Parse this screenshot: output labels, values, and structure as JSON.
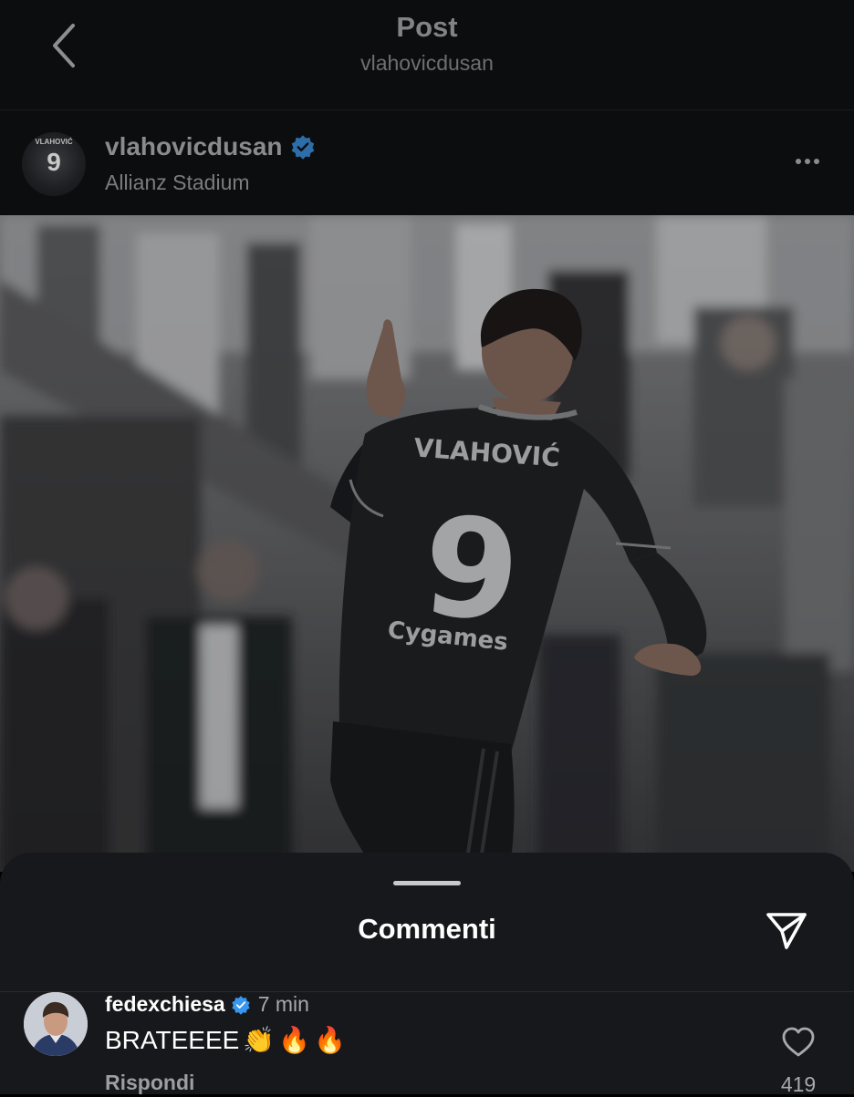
{
  "nav": {
    "title": "Post",
    "subtitle": "vlahovicdusan",
    "back_icon": "chevron-left-icon"
  },
  "post": {
    "username": "vlahovicdusan",
    "verified": true,
    "location": "Allianz Stadium",
    "more_icon": "more-horizontal-icon",
    "photo": {
      "jersey_name": "VLAHOVIĆ",
      "jersey_number": "9",
      "sponsor": "Cygames"
    },
    "avatar": {
      "name": "VLAHOVIĆ",
      "number": "9"
    }
  },
  "comments_sheet": {
    "title": "Commenti",
    "share_icon": "send-icon",
    "comments": [
      {
        "username": "fedexchiesa",
        "verified": true,
        "time": "7 min",
        "text": "BRATEEEE",
        "emojis": [
          "👏",
          "🔥",
          "🔥"
        ],
        "reply_label": "Rispondi",
        "like_count": "419",
        "like_icon": "heart-outline-icon"
      }
    ]
  },
  "colors": {
    "verified_blue": "#3897f0",
    "sheet_bg": "#17181b",
    "header_bg": "#0c0d0f"
  }
}
